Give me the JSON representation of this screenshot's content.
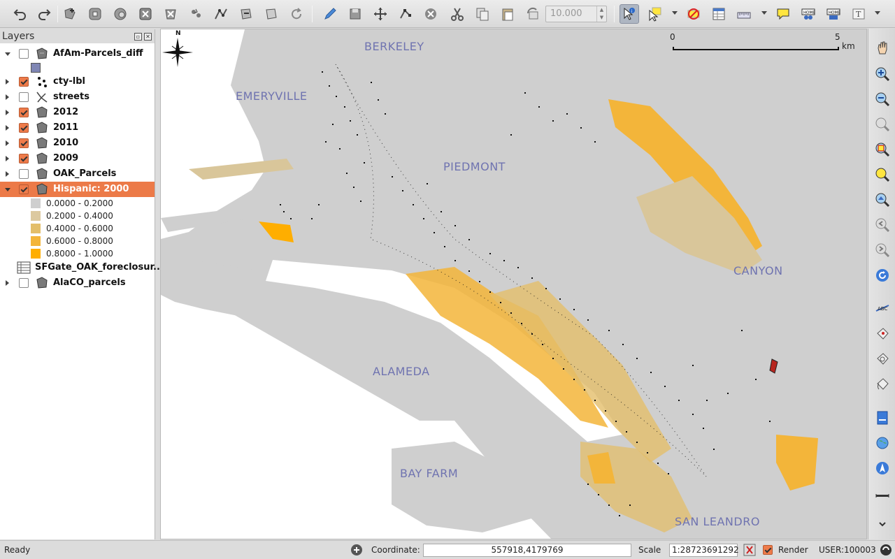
{
  "toolbar": {
    "scale_value": "10.000",
    "icons": [
      "undo-icon",
      "redo-icon",
      "add-feature-icon",
      "add-ring-icon",
      "add-part-icon",
      "fill-ring-icon",
      "delete-ring-icon",
      "delete-part-icon",
      "reshape-icon",
      "offset-curve-icon",
      "simplify-icon",
      "rotate-point-icon",
      "edit-pencil-icon",
      "save-edits-icon",
      "move-feature-icon",
      "node-tool-icon",
      "delete-selected-icon",
      "cut-features-icon",
      "copy-features-icon",
      "paste-features-icon",
      "rotate-feature-icon",
      "identify-icon",
      "select-icon",
      "deselect-icon",
      "attribute-table-icon",
      "measure-icon",
      "map-tips-icon",
      "home-icon",
      "home-set-icon",
      "text-annotation-icon"
    ]
  },
  "layers_panel": {
    "title": "Layers",
    "layers": [
      {
        "name": "AfAm-Parcels_diff",
        "checked": false,
        "expanded": true,
        "icon": "polygon-layer-icon"
      },
      {
        "name": "cty-lbl",
        "checked": true,
        "expanded": false,
        "icon": "point-layer-icon"
      },
      {
        "name": "streets",
        "checked": false,
        "expanded": false,
        "icon": "line-layer-icon"
      },
      {
        "name": "2012",
        "checked": true,
        "expanded": false,
        "icon": "polygon-layer-icon"
      },
      {
        "name": "2011",
        "checked": true,
        "expanded": false,
        "icon": "polygon-layer-icon"
      },
      {
        "name": "2010",
        "checked": true,
        "expanded": false,
        "icon": "polygon-layer-icon"
      },
      {
        "name": "2009",
        "checked": true,
        "expanded": false,
        "icon": "polygon-layer-icon"
      },
      {
        "name": "OAK_Parcels",
        "checked": false,
        "expanded": false,
        "icon": "polygon-layer-icon"
      },
      {
        "name": "Hispanic: 2000",
        "checked": true,
        "expanded": true,
        "icon": "polygon-layer-icon",
        "selected": true
      },
      {
        "name": "SFGate_OAK_foreclosur...",
        "checked": null,
        "expanded": null,
        "icon": "table-layer-icon"
      },
      {
        "name": "AlaCO_parcels",
        "checked": false,
        "expanded": false,
        "icon": "polygon-layer-icon"
      }
    ],
    "afam_swatch_color": "#7f86b4",
    "legend": [
      {
        "label": "0.0000 - 0.2000",
        "color": "#cfcfcf"
      },
      {
        "label": "0.2000 - 0.4000",
        "color": "#dcc9a0"
      },
      {
        "label": "0.4000 - 0.6000",
        "color": "#e3be6a"
      },
      {
        "label": "0.6000 - 0.8000",
        "color": "#f3b53a"
      },
      {
        "label": "0.8000 - 1.0000",
        "color": "#ffae00"
      }
    ]
  },
  "map": {
    "place_labels": [
      "BERKELEY",
      "EMERYVILLE",
      "PIEDMONT",
      "CANYON",
      "ALAMEDA",
      "BAY FARM",
      "SAN LEANDRO"
    ],
    "scalebar": {
      "start": "0",
      "end": "5",
      "unit": "km"
    },
    "north_label": "N",
    "colors": {
      "water": "#ffffff",
      "land": "#cfcfcf",
      "parcel": "#111111",
      "accent": "#ec7a48"
    }
  },
  "right_toolbar": {
    "icons": [
      "pan-icon",
      "zoom-in-icon",
      "zoom-out-icon",
      "zoom-full-icon",
      "zoom-to-selection-icon",
      "zoom-to-layer-icon",
      "zoom-actual-icon",
      "zoom-last-icon",
      "zoom-next-icon",
      "refresh-icon",
      "label-icon",
      "pin-label-icon",
      "move-label-icon",
      "rotate-label-icon",
      "new-layer-icon",
      "globe-icon",
      "north-arrow-icon",
      "scale-bar-icon",
      "more-icon"
    ]
  },
  "statusbar": {
    "status": "Ready",
    "coordinate_label": "Coordinate:",
    "coordinate_value": "557918,4179769",
    "scale_label": "Scale",
    "scale_value": "1:28723691292",
    "render_label": "Render",
    "render_checked": true,
    "user_label": "USER:100003"
  }
}
